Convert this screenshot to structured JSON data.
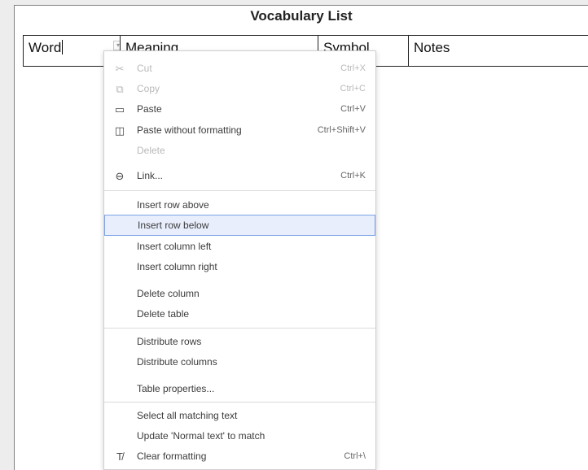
{
  "document": {
    "title": "Vocabulary List"
  },
  "table": {
    "headers": [
      "Word",
      "Meaning",
      "Symbol",
      "Notes"
    ]
  },
  "context_menu": {
    "items": [
      {
        "label": "Cut",
        "shortcut": "Ctrl+X",
        "icon": "scissors-icon",
        "disabled": true
      },
      {
        "label": "Copy",
        "shortcut": "Ctrl+C",
        "icon": "copy-icon",
        "disabled": true
      },
      {
        "label": "Paste",
        "shortcut": "Ctrl+V",
        "icon": "paste-icon",
        "disabled": false
      },
      {
        "label": "Paste without formatting",
        "shortcut": "Ctrl+Shift+V",
        "icon": "paste-plain-icon",
        "disabled": false
      },
      {
        "label": "Delete",
        "shortcut": "",
        "icon": "",
        "disabled": true
      },
      {
        "label": "Link...",
        "shortcut": "Ctrl+K",
        "icon": "link-icon",
        "disabled": false
      },
      {
        "label": "Insert row above",
        "shortcut": "",
        "icon": "",
        "disabled": false
      },
      {
        "label": "Insert row below",
        "shortcut": "",
        "icon": "",
        "disabled": false,
        "highlighted": true
      },
      {
        "label": "Insert column left",
        "shortcut": "",
        "icon": "",
        "disabled": false
      },
      {
        "label": "Insert column right",
        "shortcut": "",
        "icon": "",
        "disabled": false
      },
      {
        "label": "Delete column",
        "shortcut": "",
        "icon": "",
        "disabled": false
      },
      {
        "label": "Delete table",
        "shortcut": "",
        "icon": "",
        "disabled": false
      },
      {
        "label": "Distribute rows",
        "shortcut": "",
        "icon": "",
        "disabled": false
      },
      {
        "label": "Distribute columns",
        "shortcut": "",
        "icon": "",
        "disabled": false
      },
      {
        "label": "Table properties...",
        "shortcut": "",
        "icon": "",
        "disabled": false
      },
      {
        "label": "Select all matching text",
        "shortcut": "",
        "icon": "",
        "disabled": false
      },
      {
        "label": "Update 'Normal text' to match",
        "shortcut": "",
        "icon": "",
        "disabled": false
      },
      {
        "label": "Clear formatting",
        "shortcut": "Ctrl+\\",
        "icon": "clear-formatting-icon",
        "disabled": false
      }
    ]
  },
  "colors": {
    "highlight_bg": "#e8eefc",
    "highlight_border": "#7ea3e6",
    "disabled_text": "#b9b9b9"
  }
}
